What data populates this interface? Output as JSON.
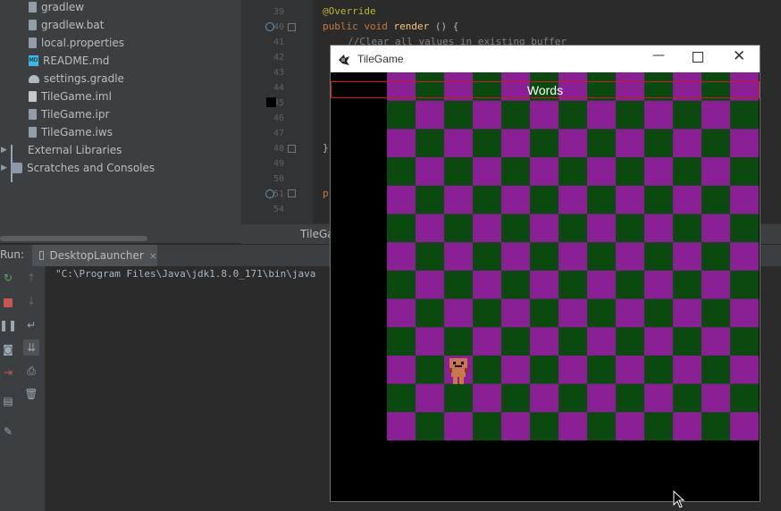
{
  "project_tree": {
    "files": [
      {
        "label": "gradlew",
        "icon": "file-icon"
      },
      {
        "label": "gradlew.bat",
        "icon": "file-icon"
      },
      {
        "label": "local.properties",
        "icon": "file-icon"
      },
      {
        "label": "README.md",
        "icon": "markdown-file-icon"
      },
      {
        "label": "settings.gradle",
        "icon": "gradle-icon"
      },
      {
        "label": "TileGame.iml",
        "icon": "iml-file-icon"
      },
      {
        "label": "TileGame.ipr",
        "icon": "file-icon"
      },
      {
        "label": "TileGame.iws",
        "icon": "file-icon"
      }
    ],
    "external_libraries": "External Libraries",
    "scratches": "Scratches and Consoles"
  },
  "editor": {
    "line_numbers": [
      "39",
      "40",
      "41",
      "42",
      "43",
      "44",
      "45",
      "46",
      "47",
      "48",
      "49",
      "50",
      "51",
      "54"
    ],
    "annotation": "@Override",
    "method_kw1": "public",
    "method_kw2": "void",
    "method_name": "render",
    "method_rest": " () {",
    "comment": "//Clear all values in existing buffer",
    "closing_brace": "}",
    "next_kw": "p",
    "tab_label": "TileGa"
  },
  "run_panel": {
    "label": "Run:",
    "tab_label": "DesktopLauncher",
    "console_line": "\"C:\\Program Files\\Java\\jdk1.8.0_171\\bin\\java"
  },
  "game_window": {
    "title": "TileGame",
    "words_label": "Words",
    "board": {
      "cols": 13,
      "rows": 13,
      "color_a": "#8a1f96",
      "color_b": "#0a4a0f"
    },
    "player_tile": {
      "col": 2,
      "row": 10
    }
  },
  "colors": {
    "accent_red": "#c41e1e",
    "annotation": "#bbb529",
    "keyword": "#cc7832",
    "comment": "#808080",
    "method": "#ffc66d"
  }
}
